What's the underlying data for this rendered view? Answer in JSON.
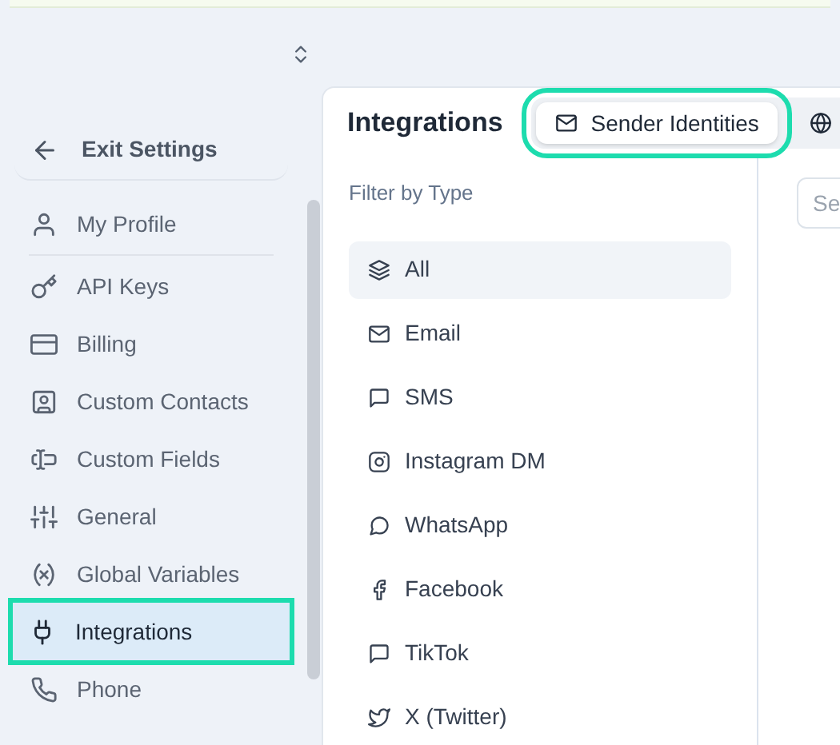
{
  "back_link": {
    "label": "Exit Settings"
  },
  "sidebar": {
    "items": [
      {
        "label": "My Profile",
        "selected": false,
        "highlighted": false
      },
      {
        "label": "API Keys",
        "selected": false,
        "highlighted": false
      },
      {
        "label": "Billing",
        "selected": false,
        "highlighted": false
      },
      {
        "label": "Custom Contacts",
        "selected": false,
        "highlighted": false
      },
      {
        "label": "Custom Fields",
        "selected": false,
        "highlighted": false
      },
      {
        "label": "General",
        "selected": false,
        "highlighted": false
      },
      {
        "label": "Global Variables",
        "selected": false,
        "highlighted": false
      },
      {
        "label": "Integrations",
        "selected": true,
        "highlighted": true
      },
      {
        "label": "Phone",
        "selected": false,
        "highlighted": false
      }
    ]
  },
  "panel": {
    "title": "Integrations",
    "tabs": [
      {
        "label": "Sender Identities",
        "selected": true,
        "highlighted": true
      },
      {
        "selected": false,
        "highlighted": false
      }
    ],
    "filter": {
      "heading": "Filter by Type",
      "items": [
        {
          "label": "All",
          "selected": true
        },
        {
          "label": "Email",
          "selected": false
        },
        {
          "label": "SMS",
          "selected": false
        },
        {
          "label": "Instagram DM",
          "selected": false
        },
        {
          "label": "WhatsApp",
          "selected": false
        },
        {
          "label": "Facebook",
          "selected": false
        },
        {
          "label": "TikTok",
          "selected": false
        },
        {
          "label": "X (Twitter)",
          "selected": false
        }
      ]
    },
    "search": {
      "placeholder": "Se"
    }
  }
}
